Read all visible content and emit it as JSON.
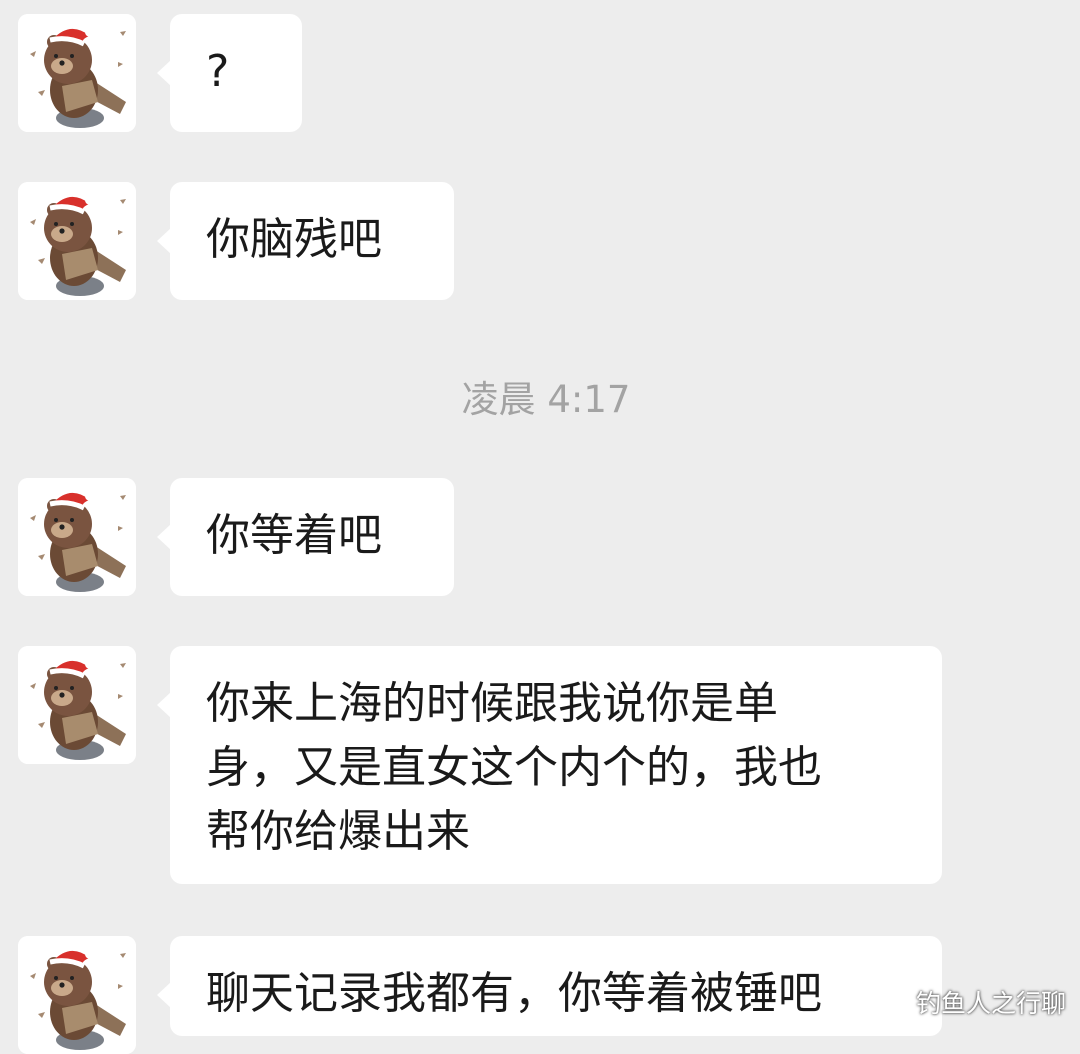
{
  "chat": {
    "messages": [
      {
        "avatar_icon": "brown-bear-santa-hat-icon",
        "text": "?"
      },
      {
        "avatar_icon": "brown-bear-santa-hat-icon",
        "text": "你脑残吧"
      },
      {
        "avatar_icon": "brown-bear-santa-hat-icon",
        "text": "你等着吧"
      },
      {
        "avatar_icon": "brown-bear-santa-hat-icon",
        "text": "你来上海的时候跟我说你是单\n身，又是直女这个内个的，我也\n帮你给爆出来"
      },
      {
        "avatar_icon": "brown-bear-santa-hat-icon",
        "text": "聊天记录我都有，你等着被锤吧"
      }
    ],
    "timestamp": "凌晨 4:17"
  },
  "watermark": "钓鱼人之行聊",
  "colors": {
    "background": "#ededed",
    "bubble": "#ffffff",
    "text": "#1a1a1a",
    "timestamp": "#a3a3a3"
  }
}
